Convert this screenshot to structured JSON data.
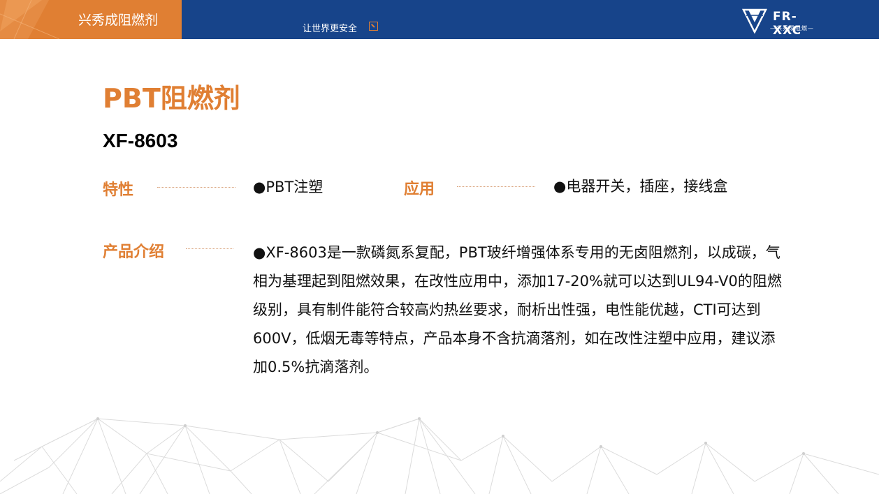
{
  "header": {
    "brand_title": "兴秀成阻燃剂",
    "slogan": "让世界更安全",
    "logo_text": "FR-XXC",
    "logo_subtext": "—兴秀成阻燃—",
    "colors": {
      "bar": "#17448a",
      "accent": "#e07f33"
    }
  },
  "main": {
    "title": "PBT阻燃剂",
    "model": "XF-8603",
    "features": {
      "label": "特性",
      "value": "●PBT注塑"
    },
    "application": {
      "label": "应用",
      "value": "●电器开关，插座，接线盒"
    },
    "intro": {
      "label": "产品介绍",
      "text": "●XF-8603是一款磷氮系复配，PBT玻纤增强体系专用的无卤阻燃剂，以成碳，气相为基理起到阻燃效果，在改性应用中，添加17-20%就可以达到UL94-V0的阻燃级别，具有制件能符合较高灼热丝要求，耐析出性强，电性能优越，CTI可达到600V，低烟无毒等特点，产品本身不含抗滴落剂，如在改性注塑中应用，建议添加0.5%抗滴落剂。"
    }
  }
}
